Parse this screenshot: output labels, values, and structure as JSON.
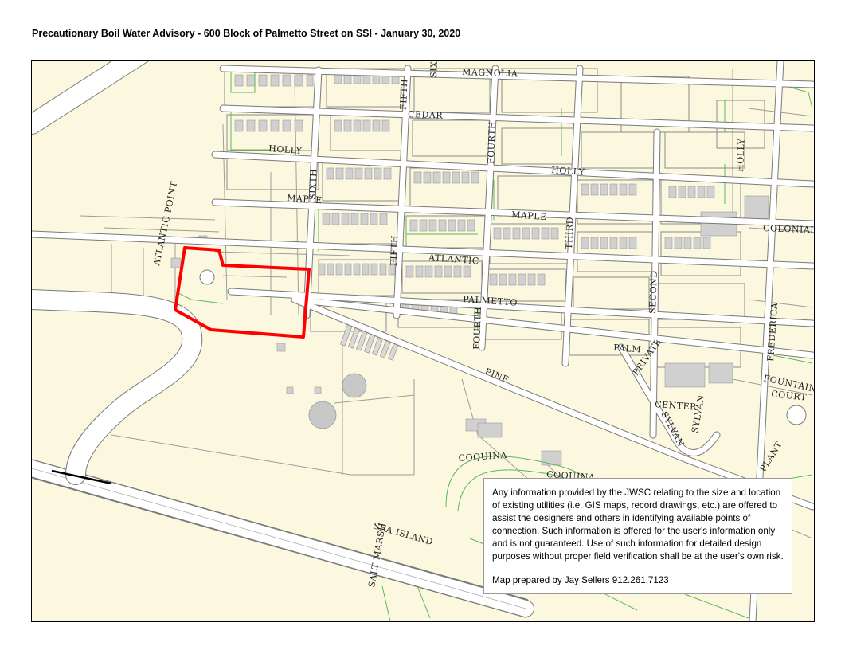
{
  "title": "Precautionary Boil Water Advisory - 600 Block of Palmetto Street on SSI - January 30, 2020",
  "colors": {
    "map_background": "#fbf8df",
    "road_fill": "#ffffff",
    "road_casing": "#7a7a7a",
    "parcel_outline": "#9c9c9c",
    "building_fill": "#d0d0d0",
    "green_line": "#5cb85c",
    "advisory_outline": "#ff0000"
  },
  "map": {
    "advisory_area_label": "advisory-area",
    "street_labels": {
      "magnolia": "MAGNOLIA",
      "fifth_north": "FIFTH",
      "sixth_top": "SIXTH",
      "cedar": "CEDAR",
      "fourth_north": "FOURTH",
      "holly_west": "HOLLY",
      "holly_east": "HOLLY",
      "holly_vertical": "HOLLY",
      "sixth": "SIXTH",
      "maple_west": "MAPLE",
      "maple_east": "MAPLE",
      "third": "THIRD",
      "atlantic_point": "ATLANTIC POINT",
      "fifth": "FIFTH",
      "atlantic": "ATLANTIC",
      "atlantic_west": "ATLANTIC",
      "colonial": "COLONIAL",
      "second": "SECOND",
      "palmetto": "PALMETTO",
      "fourth": "FOURTH",
      "frederica": "FREDERICA",
      "palm": "PALM",
      "private": "PRIVATE",
      "pine": "PINE",
      "fountain": "FOUNTAIN",
      "court": "COURT",
      "center": "CENTER",
      "sylvan_a": "SYLVAN",
      "sylvan_b": "SYLVAN",
      "coquina_a": "COQUINA",
      "coquina_b": "COQUINA",
      "plantation": "PLANT",
      "sea_island": "SEA ISLAND",
      "salt_marsh": "SALT MARSH"
    }
  },
  "disclaimer": {
    "text": "Any information provided by the JWSC relating to the size and location of existing utilities (i.e. GIS maps, record drawings, etc.) are offered to assist the designers and others in identifying available points of connection. Such information is offered for the user's information only and is not guaranteed. Use of such information for detailed design purposes without proper field verification shall be at the user's own risk.",
    "prepared_by": "Map prepared by Jay Sellers 912.261.7123"
  }
}
